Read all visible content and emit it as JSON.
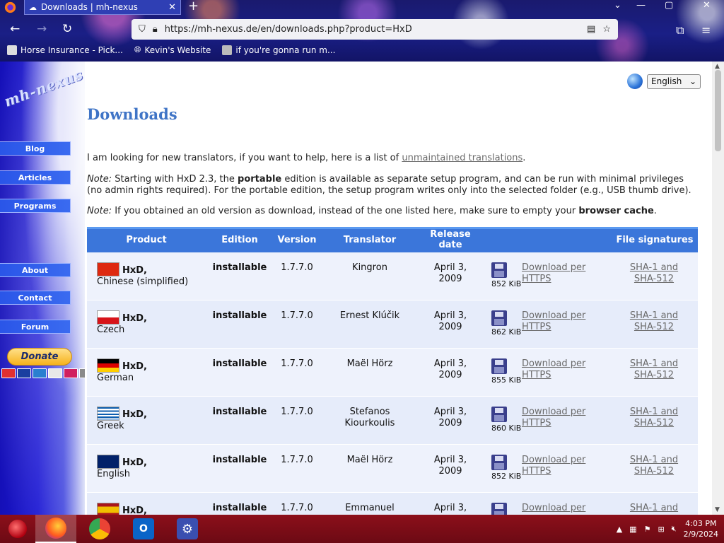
{
  "browser": {
    "tab_title": "Downloads | mh-nexus",
    "url": "https://mh-nexus.de/en/downloads.php?product=HxD",
    "bookmarks": [
      {
        "label": "Horse Insurance - Pick...",
        "icon": "horse-insurance-favicon"
      },
      {
        "label": "Kevin's Website",
        "icon": "globe-icon"
      },
      {
        "label": "if you're gonna run m...",
        "icon": "bookmark-favicon"
      }
    ]
  },
  "sidebar": {
    "logo": "mh-nexus",
    "nav": [
      "Blog",
      "Articles",
      "Programs",
      "About",
      "Contact",
      "Forum"
    ],
    "donate_label": "Donate"
  },
  "page": {
    "language": "English",
    "title": "Downloads",
    "translators_intro": "I am looking for new translators, if you want to help, here is a list of ",
    "translators_link": "unmaintained translations",
    "translators_end": ".",
    "note_label": "Note:",
    "portable_pre": " Starting with HxD 2.3, the ",
    "portable_bold": "portable",
    "portable_post": " edition is available as separate setup program, and can be run with minimal privileges (no admin rights required). For the portable edition, the setup program writes only into the selected folder (e.g., USB thumb drive).",
    "cache_pre": " If you obtained an old version as download, instead of the one listed here, make sure to empty your ",
    "cache_bold": "browser cache",
    "cache_end": "."
  },
  "table": {
    "headers": {
      "product": "Product",
      "edition": "Edition",
      "version": "Version",
      "translator": "Translator",
      "release_date": "Release date",
      "file_signatures": "File signatures"
    },
    "rows": [
      {
        "name": "HxD,",
        "language": "Chinese (simplified)",
        "edition": "installable",
        "version": "1.7.7.0",
        "translator": "Kingron",
        "date": "April 3, 2009",
        "size": "852 KiB",
        "download": "Download per HTTPS",
        "signatures": "SHA-1 and SHA-512",
        "flag": "china"
      },
      {
        "name": "HxD,",
        "language": "Czech",
        "edition": "installable",
        "version": "1.7.7.0",
        "translator": "Ernest Klúčik",
        "date": "April 3, 2009",
        "size": "862 KiB",
        "download": "Download per HTTPS",
        "signatures": "SHA-1 and SHA-512",
        "flag": "czech"
      },
      {
        "name": "HxD,",
        "language": "German",
        "edition": "installable",
        "version": "1.7.7.0",
        "translator": "Maël Hörz",
        "date": "April 3, 2009",
        "size": "855 KiB",
        "download": "Download per HTTPS",
        "signatures": "SHA-1 and SHA-512",
        "flag": "germany"
      },
      {
        "name": "HxD,",
        "language": "Greek",
        "edition": "installable",
        "version": "1.7.7.0",
        "translator": "Stefanos Kiourkoulis",
        "date": "April 3, 2009",
        "size": "860 KiB",
        "download": "Download per HTTPS",
        "signatures": "SHA-1 and SHA-512",
        "flag": "greece"
      },
      {
        "name": "HxD,",
        "language": "English",
        "edition": "installable",
        "version": "1.7.7.0",
        "translator": "Maël Hörz",
        "date": "April 3, 2009",
        "size": "852 KiB",
        "download": "Download per HTTPS",
        "signatures": "SHA-1 and SHA-512",
        "flag": "uk"
      },
      {
        "name": "HxD,",
        "language": "",
        "edition": "installable",
        "version": "1.7.7.0",
        "translator": "Emmanuel",
        "date": "April 3,",
        "size": "",
        "download": "Download per",
        "signatures": "SHA-1 and",
        "flag": "spain"
      }
    ]
  },
  "taskbar": {
    "apps": [
      "firefox",
      "chrome",
      "outlook",
      "settings"
    ],
    "time": "4:03 PM",
    "date": "2/9/2024"
  },
  "colors": {
    "heading": "#3f74c6",
    "table_header": "#3b76da",
    "taskbar": "#8c0f1a"
  }
}
